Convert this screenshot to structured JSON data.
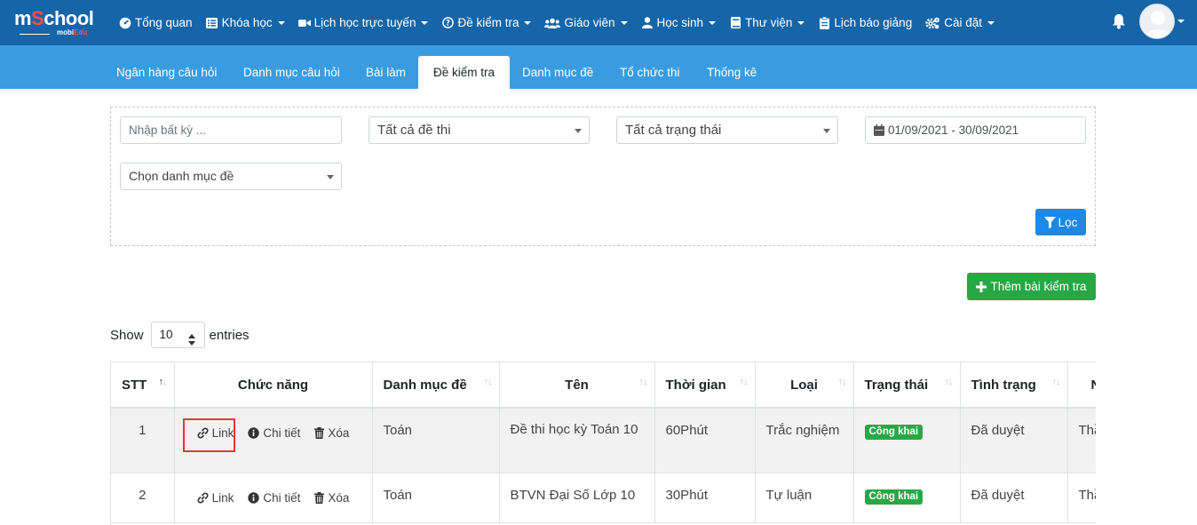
{
  "logo": {
    "brand_prefix": "m",
    "brand_s": "S",
    "brand_suffix": "chool",
    "sub_a": "mobi",
    "sub_b": "Edu"
  },
  "menu": [
    {
      "label": "Tổng quan",
      "icon": "dashboard-icon",
      "caret": false
    },
    {
      "label": "Khóa học",
      "icon": "list-icon",
      "caret": true
    },
    {
      "label": "Lịch học trực tuyến",
      "icon": "video-icon",
      "caret": true
    },
    {
      "label": "Đề kiểm tra",
      "icon": "question-circle-icon",
      "caret": true
    },
    {
      "label": "Giáo viên",
      "icon": "users-icon",
      "caret": true
    },
    {
      "label": "Học sinh",
      "icon": "user-icon",
      "caret": true
    },
    {
      "label": "Thư viện",
      "icon": "book-icon",
      "caret": true
    },
    {
      "label": "Lịch báo giảng",
      "icon": "clipboard-icon",
      "caret": false
    },
    {
      "label": "Cài đặt",
      "icon": "cogs-icon",
      "caret": true
    }
  ],
  "tabs": [
    "Ngân hàng câu hỏi",
    "Danh mục câu hỏi",
    "Bài làm",
    "Đề kiểm tra",
    "Danh mục đề",
    "Tổ chức thi",
    "Thống kê"
  ],
  "active_tab": "Đề kiểm tra",
  "filter": {
    "search_placeholder": "Nhập bất kỳ ...",
    "exam_select": "Tất cả đề thi",
    "status_select": "Tất cả trạng thái",
    "date_range": "01/09/2021 - 30/09/2021",
    "category_select": "Chọn danh mục đề",
    "filter_button": "Lọc"
  },
  "add_button": "Thêm bài kiểm tra",
  "length": {
    "show": "Show",
    "value": "10",
    "entries": "entries"
  },
  "table": {
    "headers": [
      "STT",
      "Chức năng",
      "Danh mục đề",
      "Tên",
      "Thời gian",
      "Loại",
      "Trạng thái",
      "Tình trạng",
      "N"
    ],
    "actions": {
      "link": "Link",
      "detail": "Chi tiết",
      "delete": "Xóa"
    },
    "rows": [
      {
        "stt": "1",
        "category": "Toán",
        "name": "Đề thi học kỳ Toán 10",
        "time": "60Phút",
        "type": "Trắc nghiệm",
        "status": "Công khai",
        "state": "Đã duyệt",
        "extra": "Thầ"
      },
      {
        "stt": "2",
        "category": "Toán",
        "name": "BTVN Đại Số Lớp 10",
        "time": "30Phút",
        "type": "Tự luận",
        "status": "Công khai",
        "state": "Đã duyệt",
        "extra": "Thầ"
      }
    ]
  },
  "colors": {
    "topbar": "#1565a8",
    "subbar": "#3a9ce0",
    "primary": "#1e88e5",
    "success": "#28a745",
    "highlight": "#e53935"
  }
}
